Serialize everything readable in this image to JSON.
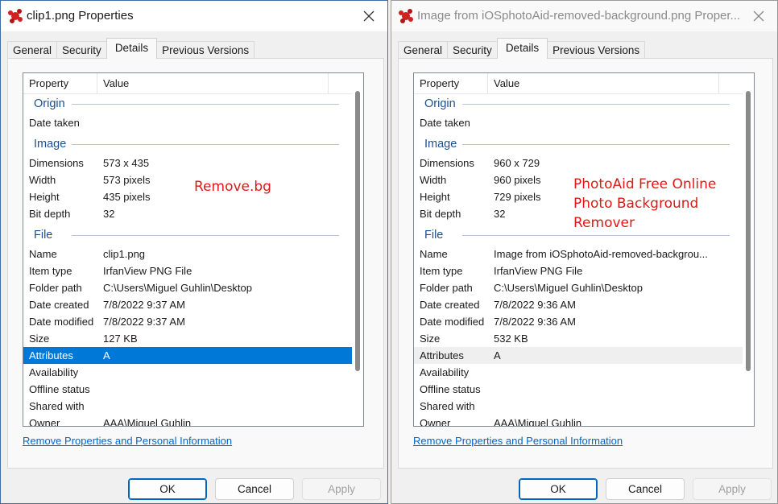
{
  "dialogs": [
    {
      "title": "clip1.png Properties",
      "tabs": [
        "General",
        "Security",
        "Details",
        "Previous Versions"
      ],
      "active_tab": "Details",
      "columns": [
        "Property",
        "Value"
      ],
      "groups": [
        {
          "name": "Origin",
          "rows": [
            {
              "property": "Date taken",
              "value": ""
            }
          ]
        },
        {
          "name": "Image",
          "rows": [
            {
              "property": "Dimensions",
              "value": "573 x 435"
            },
            {
              "property": "Width",
              "value": "573 pixels"
            },
            {
              "property": "Height",
              "value": "435 pixels"
            },
            {
              "property": "Bit depth",
              "value": "32"
            }
          ]
        },
        {
          "name": "File",
          "rows": [
            {
              "property": "Name",
              "value": "clip1.png"
            },
            {
              "property": "Item type",
              "value": "IrfanView PNG File"
            },
            {
              "property": "Folder path",
              "value": "C:\\Users\\Miguel Guhlin\\Desktop"
            },
            {
              "property": "Date created",
              "value": "7/8/2022 9:37 AM"
            },
            {
              "property": "Date modified",
              "value": "7/8/2022 9:37 AM"
            },
            {
              "property": "Size",
              "value": "127 KB"
            },
            {
              "property": "Attributes",
              "value": "A",
              "state": "selected"
            },
            {
              "property": "Availability",
              "value": ""
            },
            {
              "property": "Offline status",
              "value": ""
            },
            {
              "property": "Shared with",
              "value": ""
            },
            {
              "property": "Owner",
              "value": "AAA\\Miguel Guhlin"
            }
          ]
        }
      ],
      "annotation": [
        "Remove.bg"
      ],
      "link": "Remove Properties and Personal Information",
      "buttons": {
        "ok": "OK",
        "cancel": "Cancel",
        "apply": "Apply"
      }
    },
    {
      "title": "Image from iOSphotoAid-removed-background.png Proper...",
      "tabs": [
        "General",
        "Security",
        "Details",
        "Previous Versions"
      ],
      "active_tab": "Details",
      "columns": [
        "Property",
        "Value"
      ],
      "groups": [
        {
          "name": "Origin",
          "rows": [
            {
              "property": "Date taken",
              "value": ""
            }
          ]
        },
        {
          "name": "Image",
          "rows": [
            {
              "property": "Dimensions",
              "value": "960 x 729"
            },
            {
              "property": "Width",
              "value": "960 pixels"
            },
            {
              "property": "Height",
              "value": "729 pixels"
            },
            {
              "property": "Bit depth",
              "value": "32"
            }
          ]
        },
        {
          "name": "File",
          "rows": [
            {
              "property": "Name",
              "value": "Image from iOSphotoAid-removed-backgrou..."
            },
            {
              "property": "Item type",
              "value": "IrfanView PNG File"
            },
            {
              "property": "Folder path",
              "value": "C:\\Users\\Miguel Guhlin\\Desktop"
            },
            {
              "property": "Date created",
              "value": "7/8/2022 9:36 AM"
            },
            {
              "property": "Date modified",
              "value": "7/8/2022 9:36 AM"
            },
            {
              "property": "Size",
              "value": "532 KB"
            },
            {
              "property": "Attributes",
              "value": "A",
              "state": "highlighted"
            },
            {
              "property": "Availability",
              "value": ""
            },
            {
              "property": "Offline status",
              "value": ""
            },
            {
              "property": "Shared with",
              "value": ""
            },
            {
              "property": "Owner",
              "value": "AAA\\Miguel Guhlin"
            }
          ]
        }
      ],
      "annotation": [
        "PhotoAid Free Online",
        "Photo Background",
        "Remover"
      ],
      "link": "Remove Properties and Personal Information",
      "buttons": {
        "ok": "OK",
        "cancel": "Cancel",
        "apply": "Apply"
      }
    }
  ],
  "icons": {
    "app": "irfanview-icon",
    "close": "close-icon"
  },
  "colors": {
    "accent": "#0078d7",
    "group_header": "#1e4e8c",
    "annotation": "#e01818",
    "link": "#0066cc"
  }
}
